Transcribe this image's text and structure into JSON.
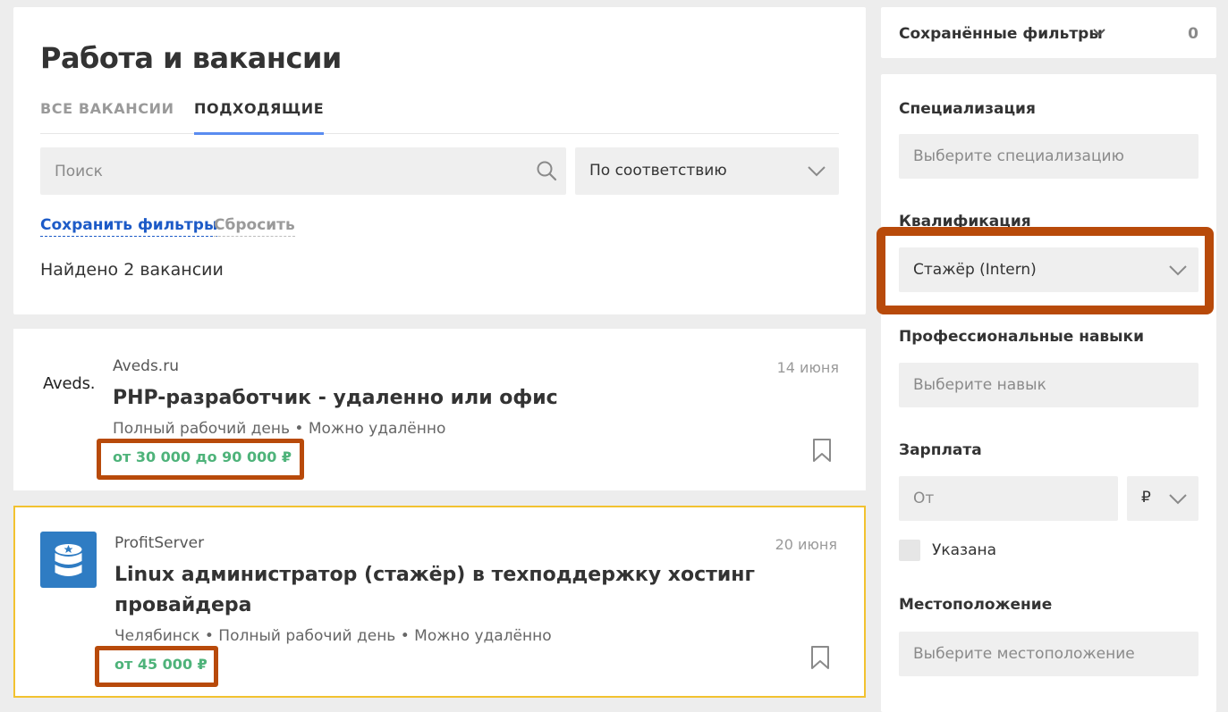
{
  "main": {
    "title": "Работа и вакансии",
    "tabs": [
      {
        "label": "ВСЕ ВАКАНСИИ",
        "active": false
      },
      {
        "label": "ПОДХОДЯЩИЕ",
        "active": true
      }
    ],
    "search": {
      "placeholder": "Поиск",
      "value": ""
    },
    "sort": {
      "selected": "По соответствию"
    },
    "save_filters_label": "Сохранить фильтры",
    "reset_label": "Сбросить",
    "found_text": "Найдено 2 вакансии"
  },
  "vacancies": [
    {
      "company": "Aveds.ru",
      "logo_text": "Aveds.",
      "date": "14 июня",
      "title": "PHP-разработчик - удаленно или офис",
      "meta": "Полный рабочий день • Можно удалённо",
      "salary": "от 30 000 до 90 000 ₽"
    },
    {
      "company": "ProfitServer",
      "date": "20 июня",
      "title": "Linux администратор (стажёр) в техподдержку хостинг провайдера",
      "meta": "Челябинск • Полный рабочий день • Можно удалённо",
      "salary": "от 45 000 ₽"
    }
  ],
  "sidebar": {
    "saved_filters": {
      "label": "Сохранённые фильтры",
      "count": "0"
    },
    "specialization": {
      "label": "Специализация",
      "placeholder": "Выберите специализацию"
    },
    "qualification": {
      "label": "Квалификация",
      "value": "Стажёр (Intern)"
    },
    "skills": {
      "label": "Профессиональные навыки",
      "placeholder": "Выберите навык"
    },
    "salary": {
      "label": "Зарплата",
      "placeholder": "От",
      "currency": "₽",
      "specified_label": "Указана"
    },
    "location": {
      "label": "Местоположение",
      "placeholder": "Выберите местоположение"
    }
  },
  "colors": {
    "accent_blue": "#5a8cf0",
    "link_blue": "#1d5bc7",
    "salary_green": "#4eb37a",
    "highlight_orange": "#b84a0a",
    "selected_card_border": "#f2c230"
  }
}
